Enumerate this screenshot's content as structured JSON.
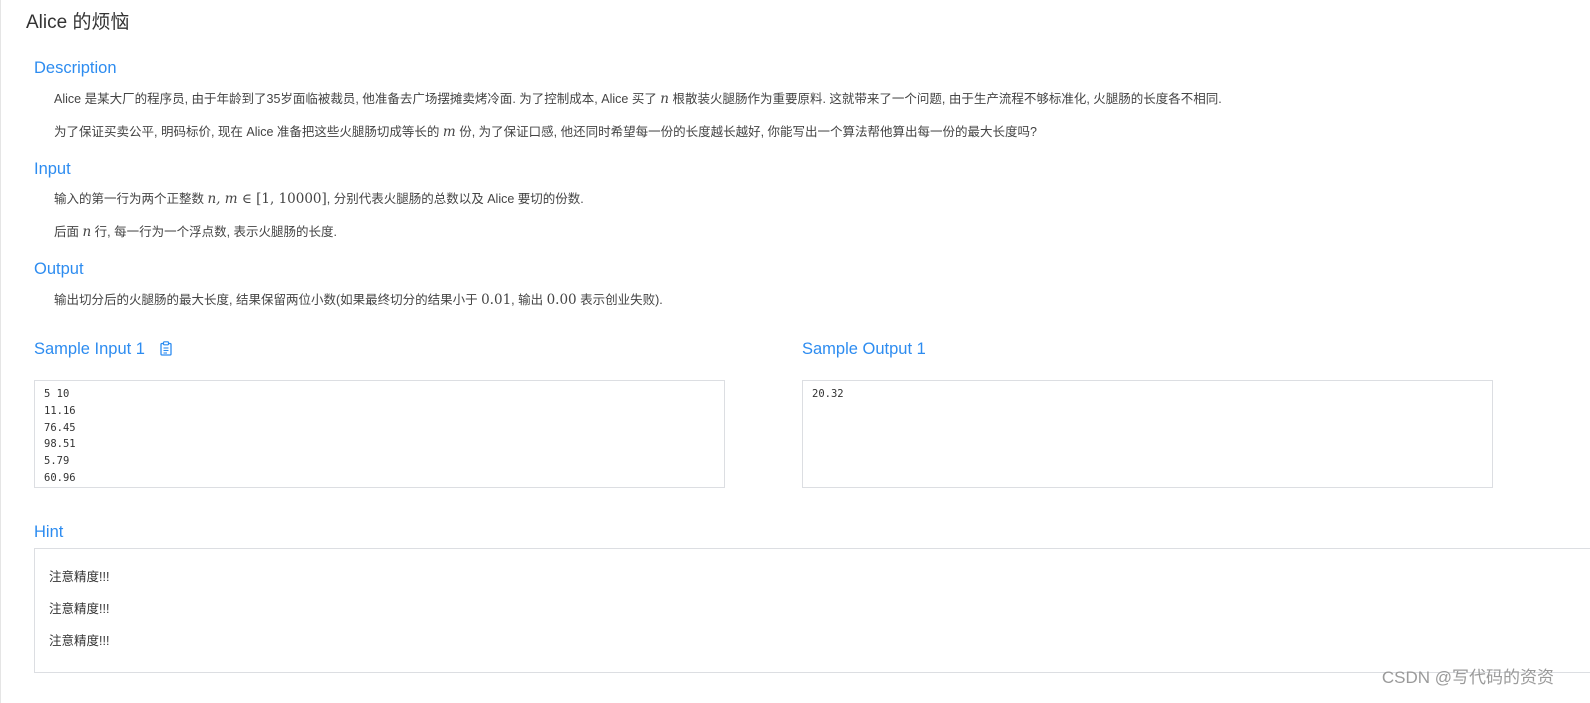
{
  "problem": {
    "title": "Alice 的烦恼"
  },
  "description": {
    "heading": "Description",
    "p1_pre": "Alice 是某大厂的程序员, 由于年龄到了35岁面临被裁员, 他准备去广场摆摊卖烤冷面. 为了控制成本, Alice 买了 ",
    "p1_var": "n",
    "p1_post": " 根散装火腿肠作为重要原料. 这就带来了一个问题, 由于生产流程不够标准化, 火腿肠的长度各不相同.",
    "p2_pre": "为了保证买卖公平, 明码标价, 现在 Alice 准备把这些火腿肠切成等长的 ",
    "p2_var": "m",
    "p2_post": " 份, 为了保证口感, 他还同时希望每一份的长度越长越好, 你能写出一个算法帮他算出每一份的最大长度吗?"
  },
  "input": {
    "heading": "Input",
    "p1_pre": "输入的第一行为两个正整数 ",
    "p1_math": "n, m ∈ ",
    "p1_range": "[1, 10000]",
    "p1_post": ", 分别代表火腿肠的总数以及 Alice 要切的份数.",
    "p2_pre": "后面 ",
    "p2_var": "n",
    "p2_post": " 行, 每一行为一个浮点数, 表示火腿肠的长度."
  },
  "output": {
    "heading": "Output",
    "p1_pre": "输出切分后的火腿肠的最大长度, 结果保留两位小数(如果最终切分的结果小于 ",
    "p1_v1": "0.01",
    "p1_mid": ", 输出 ",
    "p1_v2": "0.00",
    "p1_post": " 表示创业失败)."
  },
  "samples": {
    "input_title": "Sample Input 1",
    "input_text": "5 10\n11.16\n76.45\n98.51\n5.79\n60.96",
    "output_title": "Sample Output 1",
    "output_text": "20.32",
    "copy_icon": "clipboard-icon"
  },
  "hint": {
    "heading": "Hint",
    "lines": [
      "注意精度!!!",
      "注意精度!!!",
      "注意精度!!!"
    ]
  },
  "watermark": "CSDN @写代码的资资",
  "colors": {
    "accent": "#2d8cf0",
    "text": "#333333",
    "border": "#dcdee2"
  }
}
